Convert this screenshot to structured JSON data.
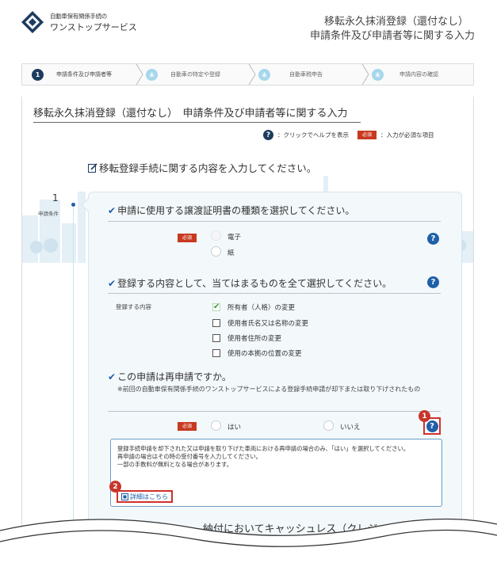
{
  "header": {
    "org_line": "自動車保有関係手続の",
    "service_name": "ワンストップサービス",
    "title_line1": "移転永久抹消登録（還付なし）",
    "title_line2": "申請条件及び申請者等に関する入力"
  },
  "steps": [
    {
      "num": "1",
      "label": "申請条件及び申請者等",
      "state": "active"
    },
    {
      "num": "未",
      "label": "自動車の特定や登録",
      "state": "inactive"
    },
    {
      "num": "未",
      "label": "自動車税申告",
      "state": "inactive"
    },
    {
      "num": "未",
      "label": "申請内容の確認",
      "state": "inactive"
    }
  ],
  "main": {
    "page_title": "移転永久抹消登録（還付なし）　申請条件及び申請者等に関する入力",
    "legend_help_icon": "?",
    "legend_help_text": "：クリックでヘルプを表示",
    "legend_required_badge": "必須",
    "legend_required_text": "：入力が必須な項目",
    "section_heading": "移転登録手続に関する内容を入力してください。",
    "side_step_number": "1",
    "side_step_label": "申請条件"
  },
  "q1": {
    "label": "申請に使用する譲渡証明書の種類を選択してください。",
    "required": "必須",
    "options": [
      "電子",
      "紙"
    ],
    "help": "?"
  },
  "q2": {
    "label": "登録する内容として、当てはまるものを全て選択してください。",
    "help": "?",
    "field_label": "登録する内容",
    "options": [
      {
        "label": "所有者（人格）の変更",
        "checked": true
      },
      {
        "label": "使用者氏名又は名称の変更",
        "checked": false
      },
      {
        "label": "使用者住所の変更",
        "checked": false
      },
      {
        "label": "使用の本拠の位置の変更",
        "checked": false
      }
    ]
  },
  "q3": {
    "label": "この申請は再申請ですか。",
    "note": "※前回の自動車保有関係手続のワンストップサービスによる登録手続申請が却下または取り下げされたもの",
    "required": "必須",
    "options": [
      "はい",
      "いいえ"
    ],
    "help": "?",
    "help_badge": "1",
    "info_text": "登録手続申請を却下された又は申請を取り下げた車両における再申請の場合のみ、「はい」を選択してください。\n再申請の場合はその時の受付番号を入力してください。\n一部の手数料が無料となる場合があります。",
    "detail_badge": "2",
    "detail_link": "詳細はこちら"
  },
  "bottom_partial_text": "納付においてキャッシュレス（クレジットカード",
  "colors": {
    "navy": "#1d3b5e",
    "help_blue": "#1f5fa8",
    "required_red": "#c8391f",
    "annotation_red": "#d0302c",
    "step_inactive": "#a6d6ec"
  }
}
